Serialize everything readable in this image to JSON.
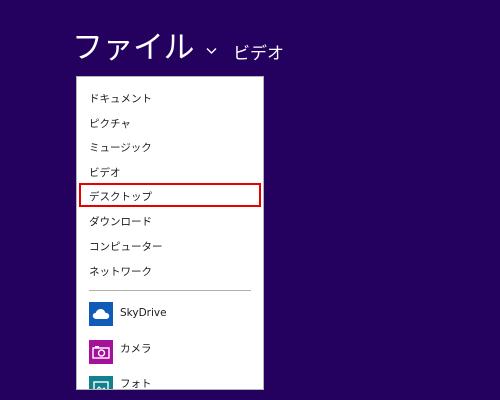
{
  "header": {
    "app_title": "ファイル",
    "location": "ビデオ"
  },
  "menu": {
    "items": [
      {
        "label": "ドキュメント"
      },
      {
        "label": "ピクチャ"
      },
      {
        "label": "ミュージック"
      },
      {
        "label": "ビデオ"
      },
      {
        "label": "デスクトップ",
        "selected": true
      },
      {
        "label": "ダウンロード"
      },
      {
        "label": "コンピューター"
      },
      {
        "label": "ネットワーク"
      }
    ],
    "apps": [
      {
        "label": "SkyDrive",
        "icon": "cloud-icon",
        "color": "#0f5bb7"
      },
      {
        "label": "カメラ",
        "icon": "camera-icon",
        "color": "#a5119b"
      },
      {
        "label": "フォト",
        "icon": "photo-icon",
        "color": "#11818d"
      }
    ]
  },
  "colors": {
    "background": "#24005f",
    "highlight": "#e60000"
  }
}
